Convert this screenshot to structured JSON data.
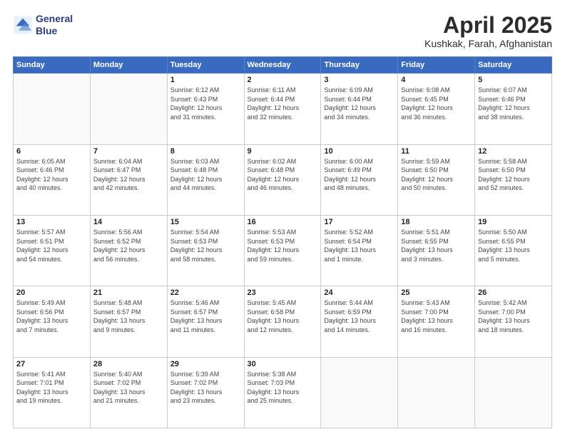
{
  "header": {
    "logo_line1": "General",
    "logo_line2": "Blue",
    "month": "April 2025",
    "location": "Kushkak, Farah, Afghanistan"
  },
  "weekdays": [
    "Sunday",
    "Monday",
    "Tuesday",
    "Wednesday",
    "Thursday",
    "Friday",
    "Saturday"
  ],
  "weeks": [
    [
      {
        "day": "",
        "info": ""
      },
      {
        "day": "",
        "info": ""
      },
      {
        "day": "1",
        "info": "Sunrise: 6:12 AM\nSunset: 6:43 PM\nDaylight: 12 hours\nand 31 minutes."
      },
      {
        "day": "2",
        "info": "Sunrise: 6:11 AM\nSunset: 6:44 PM\nDaylight: 12 hours\nand 32 minutes."
      },
      {
        "day": "3",
        "info": "Sunrise: 6:09 AM\nSunset: 6:44 PM\nDaylight: 12 hours\nand 34 minutes."
      },
      {
        "day": "4",
        "info": "Sunrise: 6:08 AM\nSunset: 6:45 PM\nDaylight: 12 hours\nand 36 minutes."
      },
      {
        "day": "5",
        "info": "Sunrise: 6:07 AM\nSunset: 6:46 PM\nDaylight: 12 hours\nand 38 minutes."
      }
    ],
    [
      {
        "day": "6",
        "info": "Sunrise: 6:05 AM\nSunset: 6:46 PM\nDaylight: 12 hours\nand 40 minutes."
      },
      {
        "day": "7",
        "info": "Sunrise: 6:04 AM\nSunset: 6:47 PM\nDaylight: 12 hours\nand 42 minutes."
      },
      {
        "day": "8",
        "info": "Sunrise: 6:03 AM\nSunset: 6:48 PM\nDaylight: 12 hours\nand 44 minutes."
      },
      {
        "day": "9",
        "info": "Sunrise: 6:02 AM\nSunset: 6:48 PM\nDaylight: 12 hours\nand 46 minutes."
      },
      {
        "day": "10",
        "info": "Sunrise: 6:00 AM\nSunset: 6:49 PM\nDaylight: 12 hours\nand 48 minutes."
      },
      {
        "day": "11",
        "info": "Sunrise: 5:59 AM\nSunset: 6:50 PM\nDaylight: 12 hours\nand 50 minutes."
      },
      {
        "day": "12",
        "info": "Sunrise: 5:58 AM\nSunset: 6:50 PM\nDaylight: 12 hours\nand 52 minutes."
      }
    ],
    [
      {
        "day": "13",
        "info": "Sunrise: 5:57 AM\nSunset: 6:51 PM\nDaylight: 12 hours\nand 54 minutes."
      },
      {
        "day": "14",
        "info": "Sunrise: 5:56 AM\nSunset: 6:52 PM\nDaylight: 12 hours\nand 56 minutes."
      },
      {
        "day": "15",
        "info": "Sunrise: 5:54 AM\nSunset: 6:53 PM\nDaylight: 12 hours\nand 58 minutes."
      },
      {
        "day": "16",
        "info": "Sunrise: 5:53 AM\nSunset: 6:53 PM\nDaylight: 12 hours\nand 59 minutes."
      },
      {
        "day": "17",
        "info": "Sunrise: 5:52 AM\nSunset: 6:54 PM\nDaylight: 13 hours\nand 1 minute."
      },
      {
        "day": "18",
        "info": "Sunrise: 5:51 AM\nSunset: 6:55 PM\nDaylight: 13 hours\nand 3 minutes."
      },
      {
        "day": "19",
        "info": "Sunrise: 5:50 AM\nSunset: 6:55 PM\nDaylight: 13 hours\nand 5 minutes."
      }
    ],
    [
      {
        "day": "20",
        "info": "Sunrise: 5:49 AM\nSunset: 6:56 PM\nDaylight: 13 hours\nand 7 minutes."
      },
      {
        "day": "21",
        "info": "Sunrise: 5:48 AM\nSunset: 6:57 PM\nDaylight: 13 hours\nand 9 minutes."
      },
      {
        "day": "22",
        "info": "Sunrise: 5:46 AM\nSunset: 6:57 PM\nDaylight: 13 hours\nand 11 minutes."
      },
      {
        "day": "23",
        "info": "Sunrise: 5:45 AM\nSunset: 6:58 PM\nDaylight: 13 hours\nand 12 minutes."
      },
      {
        "day": "24",
        "info": "Sunrise: 5:44 AM\nSunset: 6:59 PM\nDaylight: 13 hours\nand 14 minutes."
      },
      {
        "day": "25",
        "info": "Sunrise: 5:43 AM\nSunset: 7:00 PM\nDaylight: 13 hours\nand 16 minutes."
      },
      {
        "day": "26",
        "info": "Sunrise: 5:42 AM\nSunset: 7:00 PM\nDaylight: 13 hours\nand 18 minutes."
      }
    ],
    [
      {
        "day": "27",
        "info": "Sunrise: 5:41 AM\nSunset: 7:01 PM\nDaylight: 13 hours\nand 19 minutes."
      },
      {
        "day": "28",
        "info": "Sunrise: 5:40 AM\nSunset: 7:02 PM\nDaylight: 13 hours\nand 21 minutes."
      },
      {
        "day": "29",
        "info": "Sunrise: 5:39 AM\nSunset: 7:02 PM\nDaylight: 13 hours\nand 23 minutes."
      },
      {
        "day": "30",
        "info": "Sunrise: 5:38 AM\nSunset: 7:03 PM\nDaylight: 13 hours\nand 25 minutes."
      },
      {
        "day": "",
        "info": ""
      },
      {
        "day": "",
        "info": ""
      },
      {
        "day": "",
        "info": ""
      }
    ]
  ]
}
